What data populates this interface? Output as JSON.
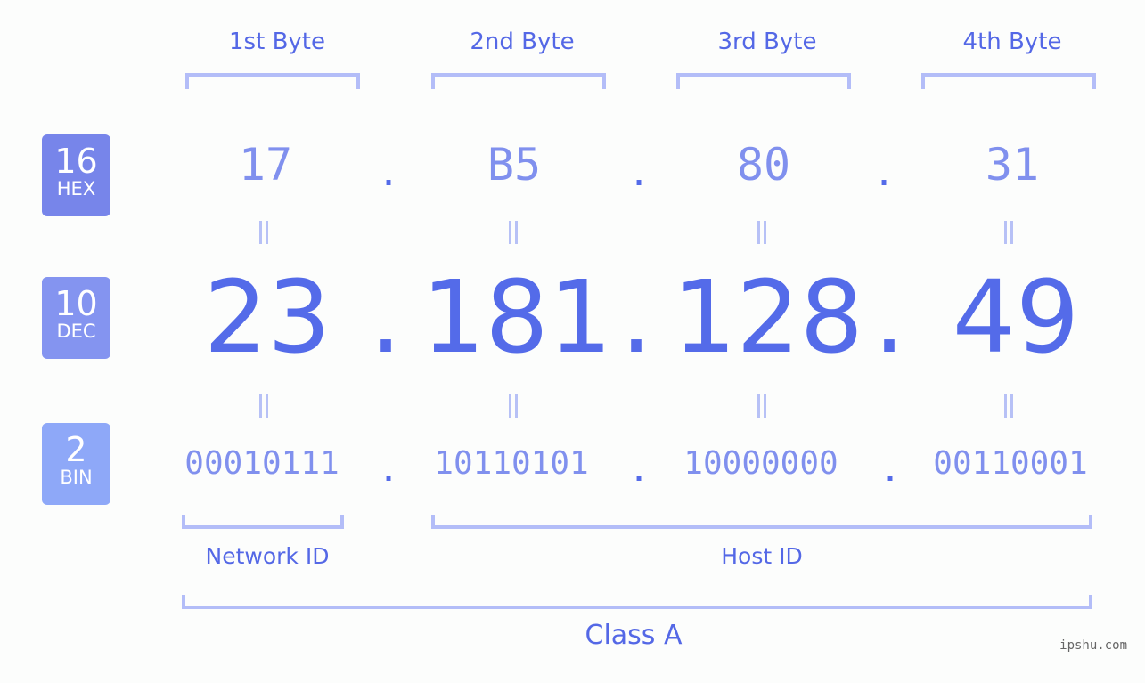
{
  "byte_headers": [
    "1st Byte",
    "2nd Byte",
    "3rd Byte",
    "4th Byte"
  ],
  "badges": [
    {
      "number": "16",
      "label": "HEX",
      "color": "#7785ea"
    },
    {
      "number": "10",
      "label": "DEC",
      "color": "#8494f0"
    },
    {
      "number": "2",
      "label": "BIN",
      "color": "#8ea8f8"
    }
  ],
  "hex": [
    "17",
    "B5",
    "80",
    "31"
  ],
  "dec": [
    "23",
    "181",
    "128",
    "49"
  ],
  "bin": [
    "00010111",
    "10110101",
    "10000000",
    "00110001"
  ],
  "separator": ".",
  "equals": "||",
  "network_label": "Network ID",
  "host_label": "Host ID",
  "class_label": "Class A",
  "watermark": "ipshu.com",
  "colors": {
    "accent": "#546be9",
    "bracket": "#b3bdf8",
    "light_text": "#8090ee"
  }
}
